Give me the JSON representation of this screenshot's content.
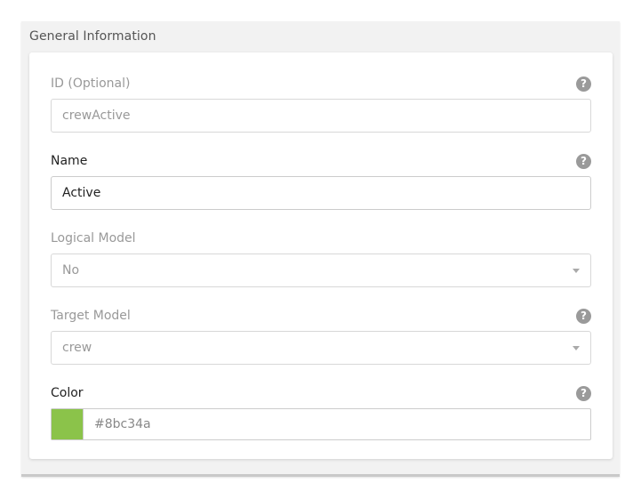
{
  "panel": {
    "title": "General Information"
  },
  "fields": {
    "id": {
      "label": "ID (Optional)",
      "value": "crewActive",
      "help_icon": "question-circle-icon"
    },
    "name": {
      "label": "Name",
      "value": "Active",
      "help_icon": "question-circle-icon"
    },
    "logical_model": {
      "label": "Logical Model",
      "selected": "No"
    },
    "target_model": {
      "label": "Target Model",
      "selected": "crew",
      "help_icon": "question-circle-icon"
    },
    "color": {
      "label": "Color",
      "value": "#8bc34a",
      "swatch_color": "#8bc34a",
      "help_icon": "question-circle-icon"
    }
  },
  "help_glyph": "?"
}
